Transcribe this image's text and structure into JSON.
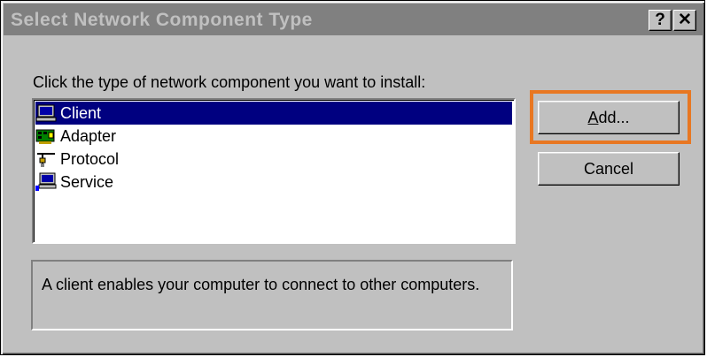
{
  "window": {
    "title": "Select Network Component Type",
    "help_label": "?",
    "close_label": "✕"
  },
  "prompt": "Click the type of network component you want to install:",
  "components": [
    {
      "label": "Client",
      "icon": "client-computer-icon",
      "selected": true
    },
    {
      "label": "Adapter",
      "icon": "network-adapter-icon",
      "selected": false
    },
    {
      "label": "Protocol",
      "icon": "protocol-icon",
      "selected": false
    },
    {
      "label": "Service",
      "icon": "service-icon",
      "selected": false
    }
  ],
  "buttons": {
    "add_accel": "A",
    "add_rest": "dd...",
    "cancel": "Cancel"
  },
  "description": "A client enables your computer to connect to other computers.",
  "colors": {
    "selection": "#000080",
    "highlight_frame": "#e87722",
    "face": "#c0c0c0",
    "inactive_title": "#808080"
  }
}
